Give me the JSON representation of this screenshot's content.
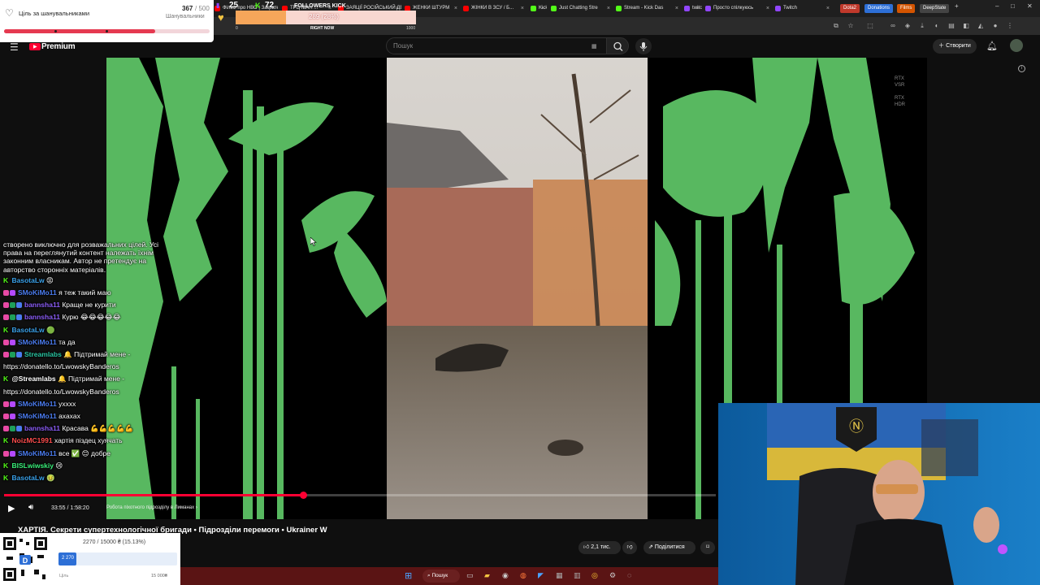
{
  "browser": {
    "tabs": [
      {
        "label": "Фільм про НВО | Закрите ...",
        "fav": "#ff0000"
      },
      {
        "label": "ТРЦ ІВАН ...",
        "fav": "#ff0000"
      },
      {
        "label": "ЗАЯЦІЇ РОСІЙСЬКИЙ ДЕ ...",
        "fav": "#ff0000"
      },
      {
        "label": "ЖЕНКИ ШТУРМ",
        "fav": "#ff0000"
      },
      {
        "label": "ЖІНКИ В ЗСУ / Б...",
        "fav": "#ff0000"
      },
      {
        "label": "Kick",
        "fav": "#53fc18"
      },
      {
        "label": "Just Chatting Stre",
        "fav": "#53fc18"
      },
      {
        "label": "Stream - Kick Das",
        "fav": "#53fc18"
      },
      {
        "label": "twitch",
        "fav": "#9146ff"
      },
      {
        "label": "Просто спілкуюсь",
        "fav": "#9146ff"
      },
      {
        "label": "Twitch",
        "fav": "#9146ff"
      }
    ],
    "chips": [
      {
        "label": "Dota2",
        "color": "#c0392b"
      },
      {
        "label": "Donations",
        "color": "#2d6fd6"
      },
      {
        "label": "Films",
        "color": "#d35400"
      },
      {
        "label": "DeepState",
        "color": "#444"
      }
    ],
    "new_tab": "+",
    "win_min": "–",
    "win_max": "□",
    "win_close": "✕"
  },
  "goal_widget": {
    "title": "Ціль за шанувальниками",
    "current": "367",
    "target": "/ 500",
    "subtitle": "Шанувальники",
    "progress": 0.734,
    "accent": "#e53950"
  },
  "kick_bar": {
    "count_a": "25",
    "count_b": "72",
    "caption": "FOLLOWERS KICK",
    "value_text": "289 (28%)",
    "min_label": "0",
    "right_now": "RIGHT NOW",
    "max_label": "1000",
    "fill": 0.28
  },
  "youtube": {
    "logo_text": "Premium",
    "search_placeholder": "Пошук",
    "create_label": "Створити",
    "search_icon": "search-icon",
    "mic_icon": "mic-icon"
  },
  "player": {
    "time": "33:55 / 1:58:20",
    "chapter": "Робота піхотного підрозділу в Лиманах",
    "progress": 0.42,
    "rtx_1": "RTX\nVSR",
    "rtx_2": "RTX\nHDR"
  },
  "video_info": {
    "title": "ХАРТІЯ. Секрети супертехнологічної бригади • Підрозділи перемоги • Ukrainer W",
    "likes": "2,1 тис.",
    "share_label": "Поділитися"
  },
  "chat": {
    "disclaimer": [
      "створено виключно для розважальних цілей. Усі",
      "права на переглянутий контент належать їхнім",
      "законним власникам. Автор не претендує на",
      "авторство сторонніх матеріалів."
    ],
    "messages": [
      {
        "platform": "kick",
        "badges": [],
        "user": "BasotaLw",
        "color": "#3aa1e9",
        "text": "😡"
      },
      {
        "platform": "twitch",
        "badges": [
          "#e84aa6",
          "#b44aff"
        ],
        "user": "SMoKiMo11",
        "color": "#4b7cf0",
        "text": "я теж такий маю"
      },
      {
        "platform": "twitch",
        "badges": [
          "#e84aa6",
          "#1e9e5a",
          "#4b7cf0"
        ],
        "user": "bannsha11",
        "color": "#8a5cf5",
        "text": "Краще не курити"
      },
      {
        "platform": "twitch",
        "badges": [
          "#e84aa6",
          "#1e9e5a",
          "#4b7cf0"
        ],
        "user": "bannsha11",
        "color": "#8a5cf5",
        "text": "Курю 😂😂😂😂😂"
      },
      {
        "platform": "kick",
        "badges": [],
        "user": "BasotaLw",
        "color": "#3aa1e9",
        "text": "🟢"
      },
      {
        "platform": "twitch",
        "badges": [
          "#e84aa6",
          "#b44aff"
        ],
        "user": "SMoKiMo11",
        "color": "#4b7cf0",
        "text": "та да"
      },
      {
        "platform": "twitch",
        "badges": [
          "#e84aa6",
          "#1e9e5a",
          "#4b7cf0"
        ],
        "user": "Streamlabs",
        "color": "#29c4a1",
        "text": "🔔 Підтримай мене -"
      },
      {
        "platform": "",
        "badges": [],
        "user": "",
        "color": "#fff",
        "text": "https://donatello.to/LwowskyBanderos"
      },
      {
        "platform": "kick",
        "badges": [],
        "user": "@Streamlabs",
        "color": "#ffffff",
        "text": "🔔 Підтримай мене -"
      },
      {
        "platform": "",
        "badges": [],
        "user": "",
        "color": "#fff",
        "text": "https://donatello.to/LwowskyBanderos"
      },
      {
        "platform": "twitch",
        "badges": [
          "#e84aa6",
          "#b44aff"
        ],
        "user": "SMoKiMo11",
        "color": "#4b7cf0",
        "text": "ухххх"
      },
      {
        "platform": "twitch",
        "badges": [
          "#e84aa6",
          "#b44aff"
        ],
        "user": "SMoKiMo11",
        "color": "#4b7cf0",
        "text": "ахахах"
      },
      {
        "platform": "twitch",
        "badges": [
          "#e84aa6",
          "#1e9e5a",
          "#4b7cf0"
        ],
        "user": "bannsha11",
        "color": "#8a5cf5",
        "text": "Красава 💪💪💪💪💪"
      },
      {
        "platform": "kick",
        "badges": [],
        "user": "NoizMC1991",
        "color": "#ff4d4d",
        "text": "хартія піздец хуячать"
      },
      {
        "platform": "twitch",
        "badges": [
          "#e84aa6",
          "#b44aff"
        ],
        "user": "SMoKiMo11",
        "color": "#4b7cf0",
        "text": "все ✅ 😊 добре"
      },
      {
        "platform": "kick",
        "badges": [],
        "user": "BISLwiwskiy",
        "color": "#3af07a",
        "text": "😢"
      },
      {
        "platform": "kick",
        "badges": [],
        "user": "BasotaLw",
        "color": "#3aa1e9",
        "text": "🤢"
      }
    ]
  },
  "donation": {
    "amount_text": "2270 / 15000 ₴ (15.13%)",
    "badge_value": "2 270",
    "min_label": "Ціль",
    "max_label": "15 000₴",
    "fill": 0.1513
  },
  "taskbar": {
    "search_label": "Пошук"
  }
}
